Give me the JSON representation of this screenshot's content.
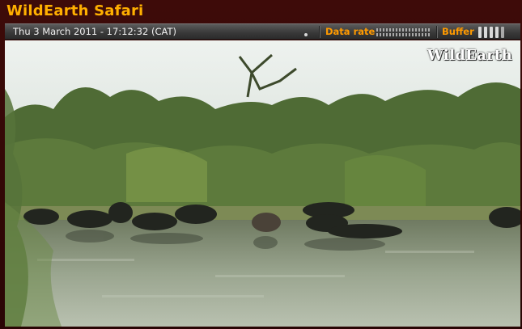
{
  "app": {
    "title": "WildEarth Safari"
  },
  "infobar": {
    "datetime": "Thu 3 March 2011 - 17:12:32 (CAT)",
    "data_rate_label": "Data rate",
    "buffer_label": "Buffer"
  },
  "video": {
    "watermark": "WildEarth"
  },
  "colors": {
    "title": "#ffb000",
    "accent": "#ff9a00",
    "frame": "#3a0a08"
  }
}
